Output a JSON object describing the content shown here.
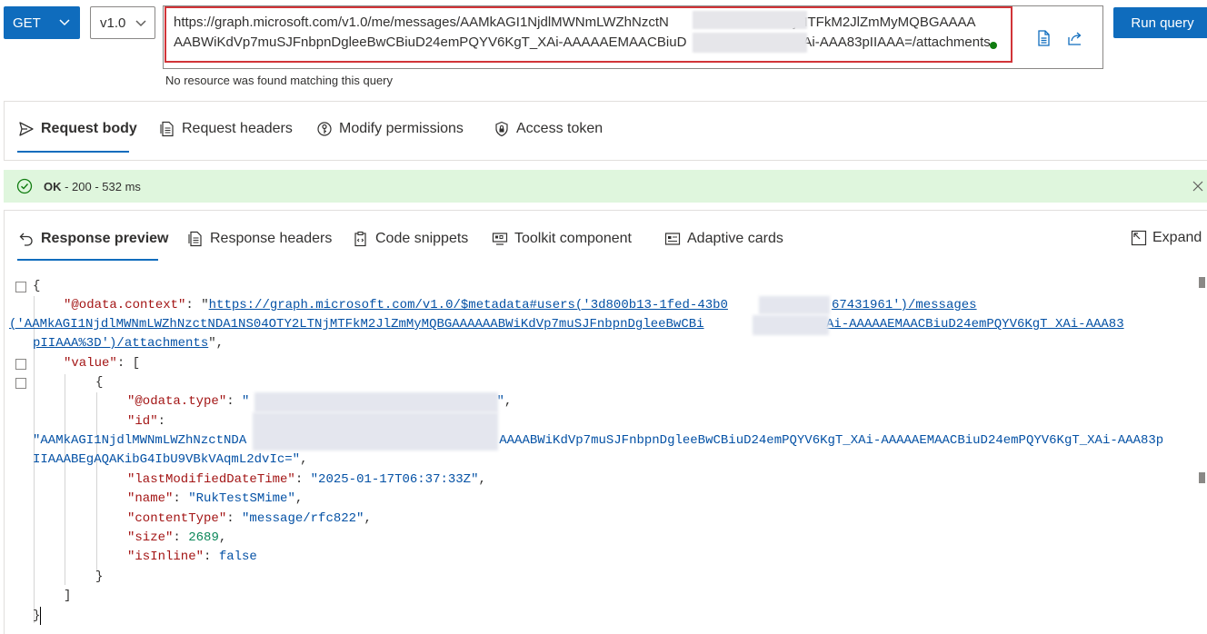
{
  "query": {
    "method": "GET",
    "version": "v1.0",
    "url_line1": "https://graph.microsoft.com/v1.0/me/messages/AAMkAGI1NjdlMWNmLWZhNzctN",
    "url_line1_tail": "NjMTFkM2JlZmMyMQBGAAAA",
    "url_line2": "AABWiKdVp7muSJFnbpnDgleeBwCBiuD24emPQYV6KgT_XAi-AAAAAEMAACBiuD",
    "url_line2_tail": "XAi-AAA83pIIAAA=/attachments",
    "run_label": "Run query",
    "message": "No resource was found matching this query"
  },
  "request_tabs": [
    {
      "label": "Request body",
      "icon": "send-icon"
    },
    {
      "label": "Request headers",
      "icon": "document-icon"
    },
    {
      "label": "Modify permissions",
      "icon": "lock-key-icon"
    },
    {
      "label": "Access token",
      "icon": "shield-lock-icon"
    }
  ],
  "status": {
    "ok": "OK",
    "detail": " - 200 - 532 ms"
  },
  "response_tabs": [
    {
      "label": "Response preview",
      "icon": "undo-icon"
    },
    {
      "label": "Response headers",
      "icon": "document-icon"
    },
    {
      "label": "Code snippets",
      "icon": "clipboard-icon"
    },
    {
      "label": "Toolkit component",
      "icon": "component-icon"
    },
    {
      "label": "Adaptive cards",
      "icon": "card-icon"
    }
  ],
  "expand_label": "Expand",
  "json": {
    "context_key": "\"@odata.context\"",
    "context_val_1a": "https://graph.microsoft.com/v1.0/$metadata#users('3d800b13-1fed-43b0",
    "context_val_1b": "67431961')/messages",
    "context_val_2a": "('AAMkAGI1NjdlMWNmLWZhNzctNDA1NS04OTY2LTNjMTFkM2JlZmMyMQBGAAAAAABWiKdVp7muSJFnbpnDgleeBwCBi",
    "context_val_2b": "6KgT_XAi-AAAAAEMAACBiuD24emPQYV6KgT_XAi-AAA83",
    "context_val_3": "pIIAAA%3D')/attachments",
    "value_key": "\"value\"",
    "type_key": "\"@odata.type\"",
    "id_key": "\"id\"",
    "id_val_1a": "\"AAMkAGI1NjdlMWNmLWZhNzctNDA",
    "id_val_1b": "AAAABWiKdVp7muSJFnbpnDgleeBwCBiuD24emPQYV6KgT_XAi-AAAAAEMAACBiuD24emPQYV6KgT_XAi-AAA83p",
    "id_val_2": "IIAAABEgAQAKibG4IbU9VBkVAqmL2dvIc=\"",
    "modified_key": "\"lastModifiedDateTime\"",
    "modified_val": "\"2025-01-17T06:37:33Z\"",
    "name_key": "\"name\"",
    "name_val": "\"RukTestSMime\"",
    "ctype_key": "\"contentType\"",
    "ctype_val": "\"message/rfc822\"",
    "size_key": "\"size\"",
    "size_val": "2689",
    "inline_key": "\"isInline\"",
    "inline_val": "false"
  },
  "colors": {
    "accent": "#0f6cbd",
    "highlight_border": "#d13438",
    "status_bg": "#dff6dd",
    "json_key": "#a31515",
    "json_string": "#0451a5",
    "json_number": "#098658"
  }
}
